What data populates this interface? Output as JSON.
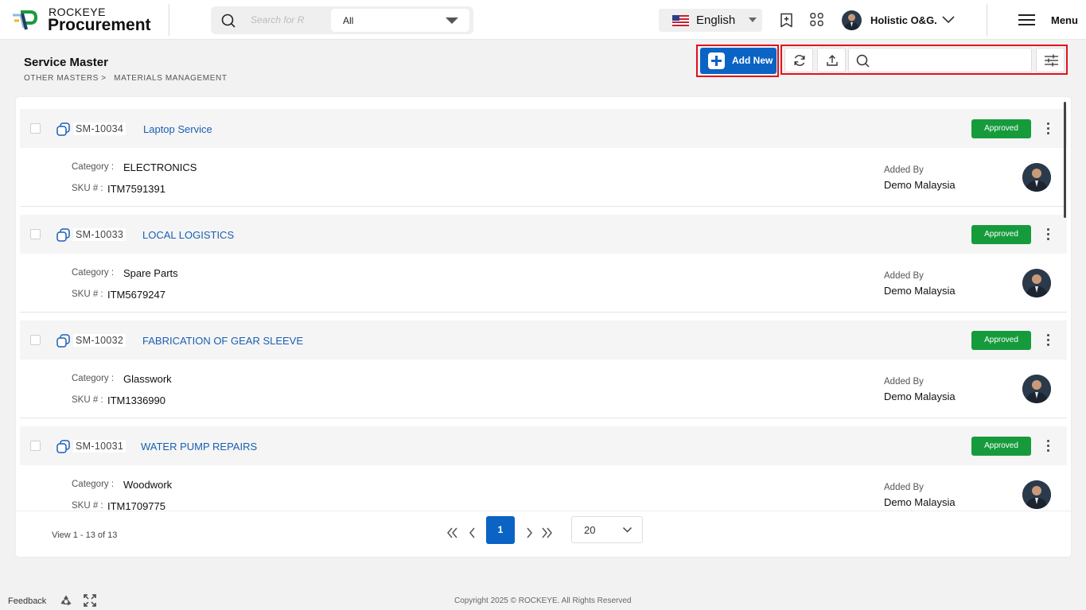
{
  "app": {
    "brand_small": "ROCKEYE",
    "brand_big": "Procurement"
  },
  "header": {
    "search_placeholder": "Search for R",
    "scope_selected": "All",
    "language": "English",
    "user_name": "Holistic O&G.",
    "menu_label": "Menu"
  },
  "page": {
    "title": "Service Master",
    "breadcrumb": [
      "OTHER MASTERS >",
      "MATERIALS MANAGEMENT"
    ],
    "add_new_label": "Add New",
    "list_search_value": ""
  },
  "labels": {
    "category": "Category :",
    "sku": "SKU # :",
    "added_by": "Added By"
  },
  "items": [
    {
      "code": "SM-10034",
      "name": "Laptop Service",
      "status": "Approved",
      "category": "ELECTRONICS",
      "sku": "ITM7591391",
      "added_by": "Demo Malaysia"
    },
    {
      "code": "SM-10033",
      "name": "LOCAL LOGISTICS",
      "status": "Approved",
      "category": "Spare Parts",
      "sku": "ITM5679247",
      "added_by": "Demo Malaysia"
    },
    {
      "code": "SM-10032",
      "name": "FABRICATION OF GEAR SLEEVE",
      "status": "Approved",
      "category": "Glasswork",
      "sku": "ITM1336990",
      "added_by": "Demo Malaysia"
    },
    {
      "code": "SM-10031",
      "name": "WATER PUMP REPAIRS",
      "status": "Approved",
      "category": "Woodwork",
      "sku": "ITM1709775",
      "added_by": "Demo Malaysia"
    }
  ],
  "pagination": {
    "view_info": "View 1 - 13 of 13",
    "current_page": "1",
    "page_size": "20"
  },
  "footer": {
    "feedback": "Feedback",
    "copyright": "Copyright 2025 © ROCKEYE. All Rights Reserved"
  },
  "colors": {
    "primary": "#0b63c4",
    "approved": "#169b3c",
    "highlight_frame": "#e3101a",
    "link": "#1a5fb4"
  }
}
